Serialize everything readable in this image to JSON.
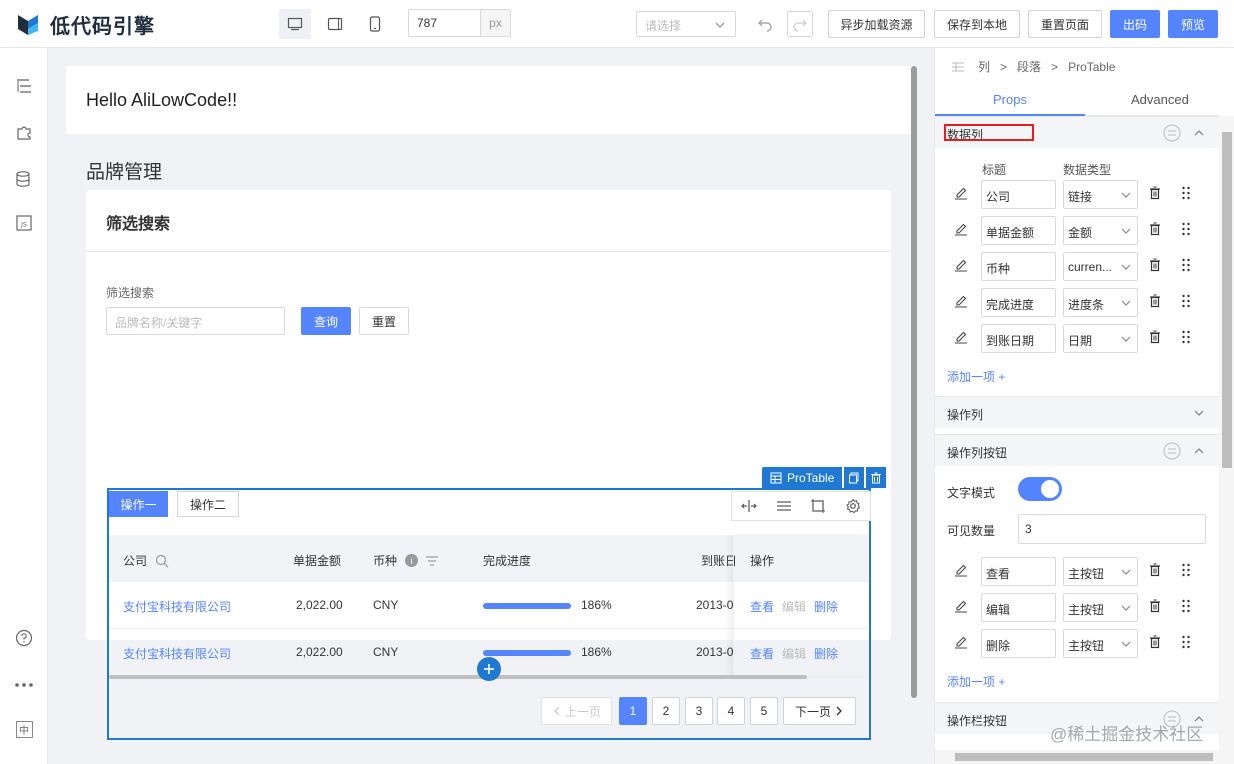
{
  "app": {
    "logo_text": "低代码引擎",
    "brand_colors": {
      "logo_dark": "#1f2d3d",
      "logo_blue": "#1f78d1",
      "logo_cyan": "#44b6f5"
    }
  },
  "topbar": {
    "devices": [
      "desktop-icon",
      "tablet-icon",
      "phone-icon"
    ],
    "width_value": "787",
    "width_unit": "px",
    "select_placeholder": "请选择",
    "buttons": {
      "async_load": "异步加载资源",
      "save_local": "保存到本地",
      "reset_page": "重置页面",
      "export_code": "出码",
      "preview": "预览"
    }
  },
  "leftbar": {
    "icons": [
      "outline-tree-icon",
      "component-puzzle-icon",
      "datasource-icon",
      "js-code-icon",
      "help-icon",
      "more-icon",
      "language-zh-icon"
    ],
    "language_glyph": "中"
  },
  "canvas": {
    "hello_text": "Hello AliLowCode!!",
    "page_title": "品牌管理",
    "card_title": "筛选搜索",
    "filter_label": "筛选搜索",
    "filter_placeholder": "品牌名称/关键字",
    "query_label": "查询",
    "reset_label": "重置",
    "protable_tag": "ProTable",
    "tabs": [
      "操作一",
      "操作二"
    ],
    "columns": [
      "公司",
      "单据金额",
      "币种",
      "完成进度",
      "到账日",
      "操作"
    ],
    "rows": [
      {
        "company": "支付宝科技有限公司",
        "amount": "2,022.00",
        "currency": "CNY",
        "progress_text": "186%",
        "progress_fraction": 1.0,
        "date": "2013-0",
        "actions": [
          "查看",
          "编辑",
          "删除"
        ]
      },
      {
        "company": "支付宝科技有限公司",
        "amount": "2,022.00",
        "currency": "CNY",
        "progress_text": "186%",
        "progress_fraction": 1.0,
        "date": "2013-0",
        "actions": [
          "查看",
          "编辑",
          "删除"
        ]
      }
    ],
    "pagination": {
      "prev": "上一页",
      "pages": [
        "1",
        "2",
        "3",
        "4",
        "5"
      ],
      "current": "1",
      "next": "下一页"
    }
  },
  "rightpanel": {
    "breadcrumb": [
      "列",
      "段落",
      "ProTable"
    ],
    "tabs": [
      "Props",
      "Advanced"
    ],
    "section_data_columns": "数据列",
    "col_headers": {
      "title": "标题",
      "type": "数据类型"
    },
    "data_columns": [
      {
        "title": "公司",
        "type": "链接"
      },
      {
        "title": "单据金额",
        "type": "金额"
      },
      {
        "title": "币种",
        "type": "curren..."
      },
      {
        "title": "完成进度",
        "type": "进度条"
      },
      {
        "title": "到账日期",
        "type": "日期"
      }
    ],
    "add_item": "添加一项 +",
    "section_op_column": "操作列",
    "section_op_buttons": "操作列按钮",
    "text_mode_label": "文字模式",
    "text_mode_on": true,
    "visible_count_label": "可见数量",
    "visible_count_value": "3",
    "op_buttons": [
      {
        "title": "查看",
        "type": "主按钮"
      },
      {
        "title": "编辑",
        "type": "主按钮"
      },
      {
        "title": "删除",
        "type": "主按钮"
      }
    ],
    "add_item_2": "添加一项 +",
    "section_toolbar_buttons": "操作栏按钮"
  },
  "watermark": "@稀土掘金技术社区"
}
